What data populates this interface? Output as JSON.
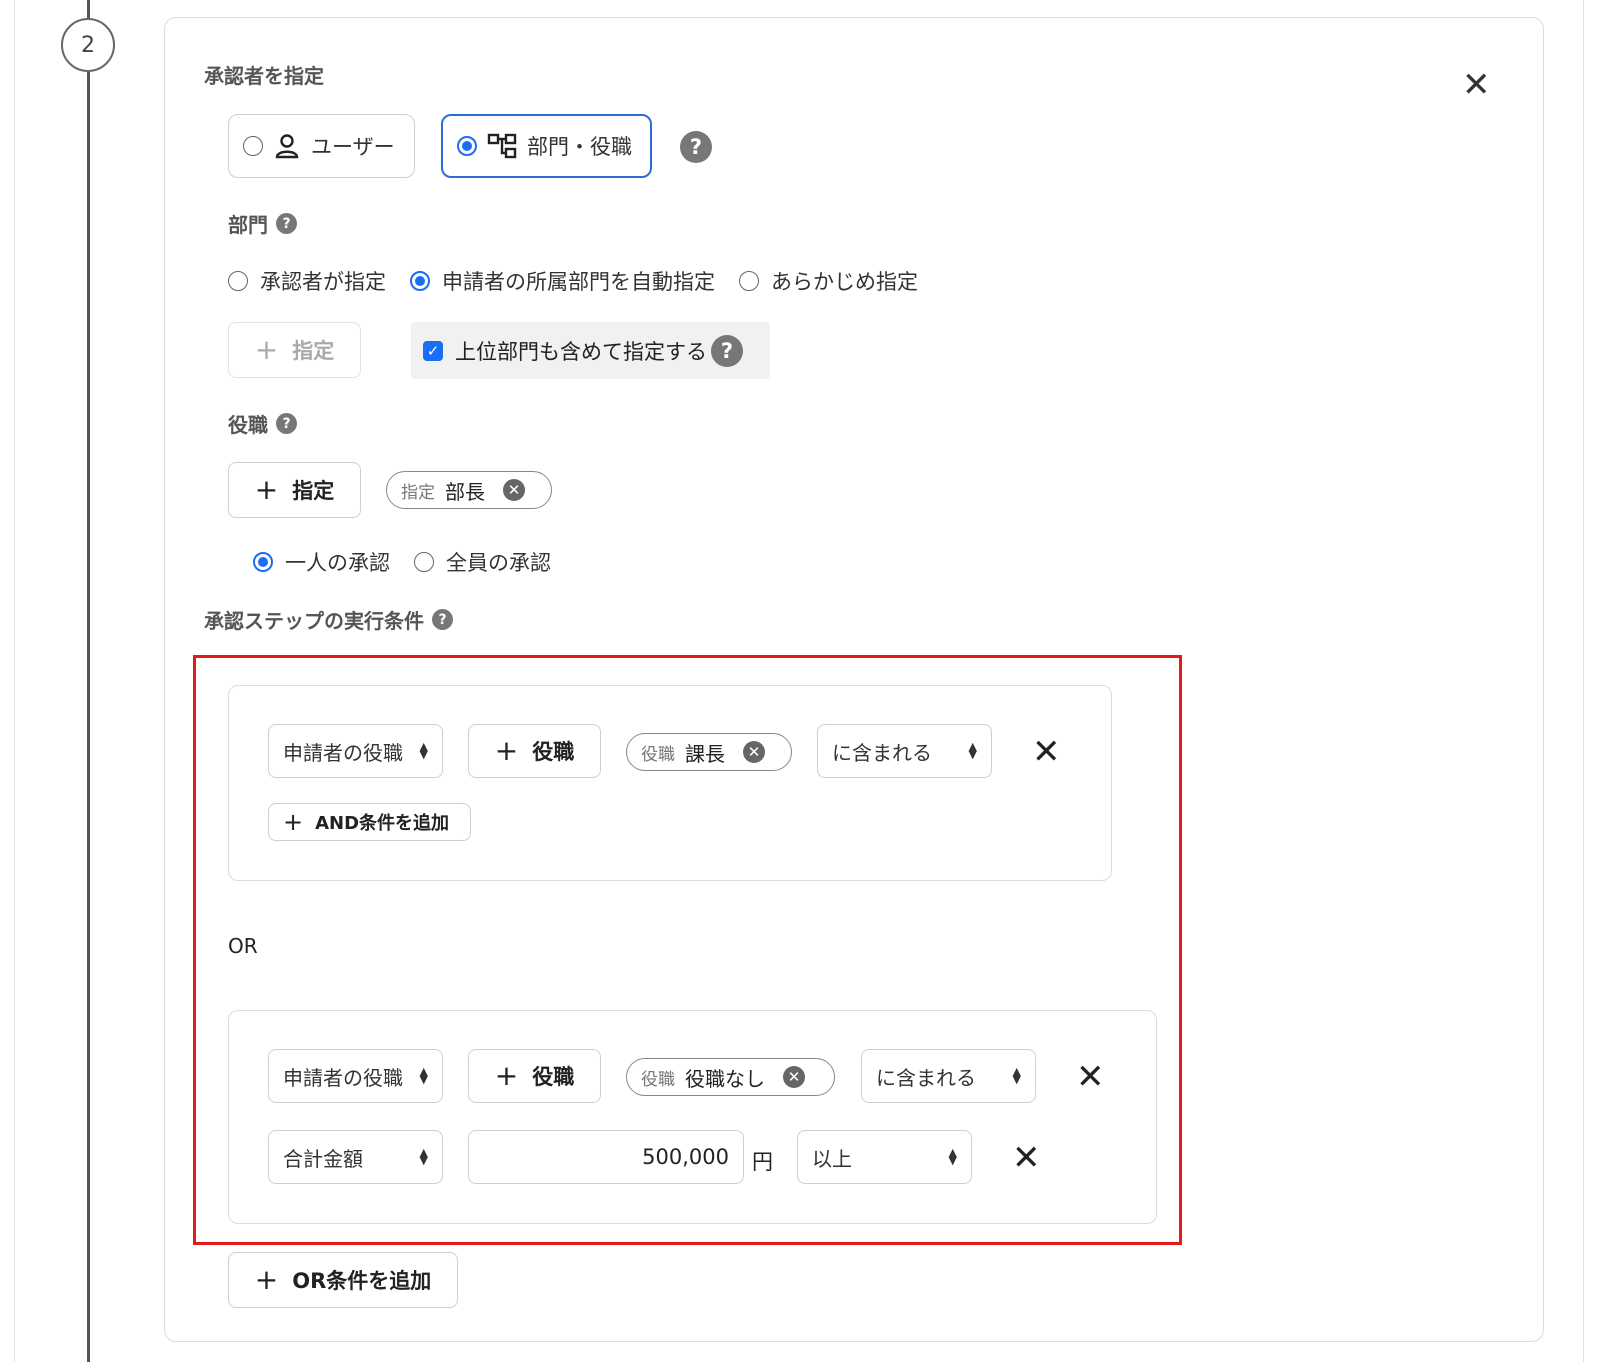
{
  "step": {
    "number": "2"
  },
  "approver": {
    "title": "承認者を指定",
    "mode_user_label": "ユーザー",
    "mode_dept_label": "部門・役職"
  },
  "department": {
    "label": "部門",
    "options": [
      "承認者が指定",
      "申請者の所属部門を自動指定",
      "あらかじめ指定"
    ],
    "specify_button": "指定",
    "include_parent_label": "上位部門も含めて指定する"
  },
  "position": {
    "label": "役職",
    "specify_button": "指定",
    "chip_tag": "指定",
    "chip_value": "部長",
    "approval_options": [
      "一人の承認",
      "全員の承認"
    ]
  },
  "conditions": {
    "title": "承認ステップの実行条件",
    "or_label": "OR",
    "group1": {
      "field_select": "申請者の役職",
      "add_position_button": "役職",
      "chip_tag": "役職",
      "chip_value": "課長",
      "operator_select": "に含まれる",
      "add_and_button": "AND条件を追加"
    },
    "group2": {
      "row1": {
        "field_select": "申請者の役職",
        "add_position_button": "役職",
        "chip_tag": "役職",
        "chip_value": "役職なし",
        "operator_select": "に含まれる"
      },
      "row2": {
        "field_select": "合計金額",
        "amount_value": "500,000",
        "unit": "円",
        "operator_select": "以上"
      }
    },
    "add_or_button": "OR条件を追加"
  },
  "colors": {
    "accent": "#1a6ef5",
    "highlight": "#e21a1a"
  }
}
